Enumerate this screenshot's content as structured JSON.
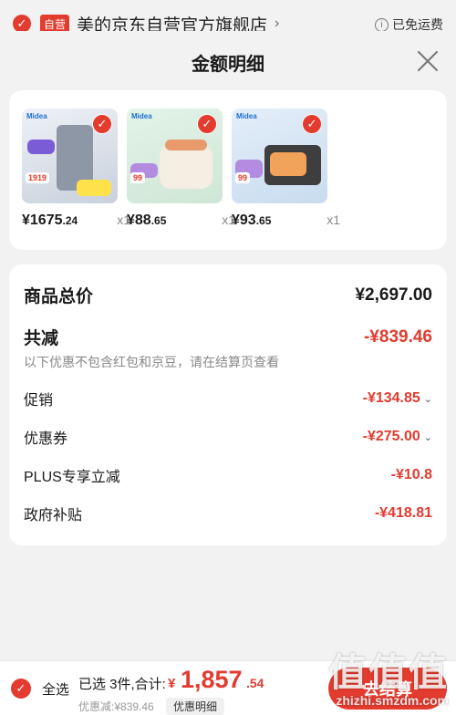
{
  "store": {
    "self_tag": "自营",
    "name": "美的京东自营官方旗舰店",
    "chevron": "›",
    "free_shipping": "已免运费",
    "info_icon": "i"
  },
  "sheet": {
    "title": "金额明细",
    "close_icon": "close-icon"
  },
  "products": [
    {
      "brand": "Midea",
      "price_yen": "¥1675",
      "price_dec": ".24",
      "qty": "x1",
      "tag": "1919",
      "colors": [
        "#e9ecf2",
        "#9aa3b1"
      ]
    },
    {
      "brand": "Midea",
      "price_yen": "¥88",
      "price_dec": ".65",
      "qty": "x1",
      "tag": "99",
      "colors": [
        "#dff0e4",
        "#f4f0e6"
      ]
    },
    {
      "brand": "Midea",
      "price_yen": "¥93",
      "price_dec": ".65",
      "qty": "x1",
      "tag": "99",
      "colors": [
        "#dce9f6",
        "#4b4b4b"
      ]
    }
  ],
  "summary": {
    "total_label": "商品总价",
    "total_value": "¥2,697.00",
    "reduce_label": "共减",
    "reduce_value": "-¥839.46",
    "note": "以下优惠不包含红包和京豆，请在结算页查看",
    "items": [
      {
        "label": "促销",
        "value": "-¥134.85",
        "expand": true
      },
      {
        "label": "优惠券",
        "value": "-¥275.00",
        "expand": true
      },
      {
        "label": "PLUS专享立减",
        "value": "-¥10.8",
        "expand": false
      },
      {
        "label": "政府补贴",
        "value": "-¥418.81",
        "expand": false
      }
    ]
  },
  "bottom_bar": {
    "select_all": "全选",
    "selected_text": "已选 3件,合计:",
    "total_yen": "¥",
    "total_main": "1,857",
    "total_dec": ".54",
    "discount_text": "优惠减:¥839.46",
    "detail_button": "优惠明细",
    "checkout_button": "去结算"
  },
  "watermark": {
    "big": "值值值",
    "small": "zhizhi.smzdm.com"
  },
  "colors": {
    "accent": "#e33b2e",
    "price_red": "#e23b2f"
  }
}
